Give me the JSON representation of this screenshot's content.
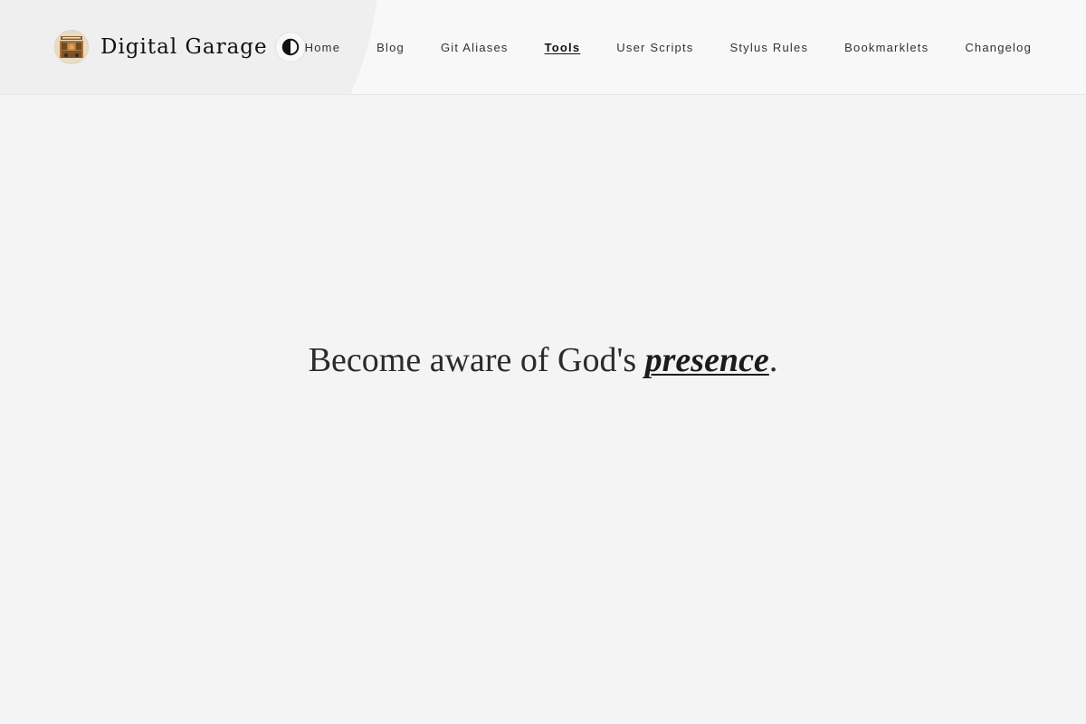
{
  "header": {
    "site_title": "Digital Garage",
    "logo_icon": "garage-logo-icon",
    "theme_toggle_icon": "half-circle-contrast-icon"
  },
  "nav": {
    "items": [
      {
        "label": "Home",
        "active": false
      },
      {
        "label": "Blog",
        "active": false
      },
      {
        "label": "Git Aliases",
        "active": false
      },
      {
        "label": "Tools",
        "active": true
      },
      {
        "label": "User Scripts",
        "active": false
      },
      {
        "label": "Stylus Rules",
        "active": false
      },
      {
        "label": "Bookmarklets",
        "active": false
      },
      {
        "label": "Changelog",
        "active": false
      }
    ]
  },
  "hero": {
    "text_before": "Become aware of God's ",
    "emphasis": "presence",
    "text_after": "."
  },
  "colors": {
    "background": "#f4f4f4",
    "header_background": "#f8f8f8",
    "text": "#2b2b2b",
    "nav_text": "#333333"
  }
}
